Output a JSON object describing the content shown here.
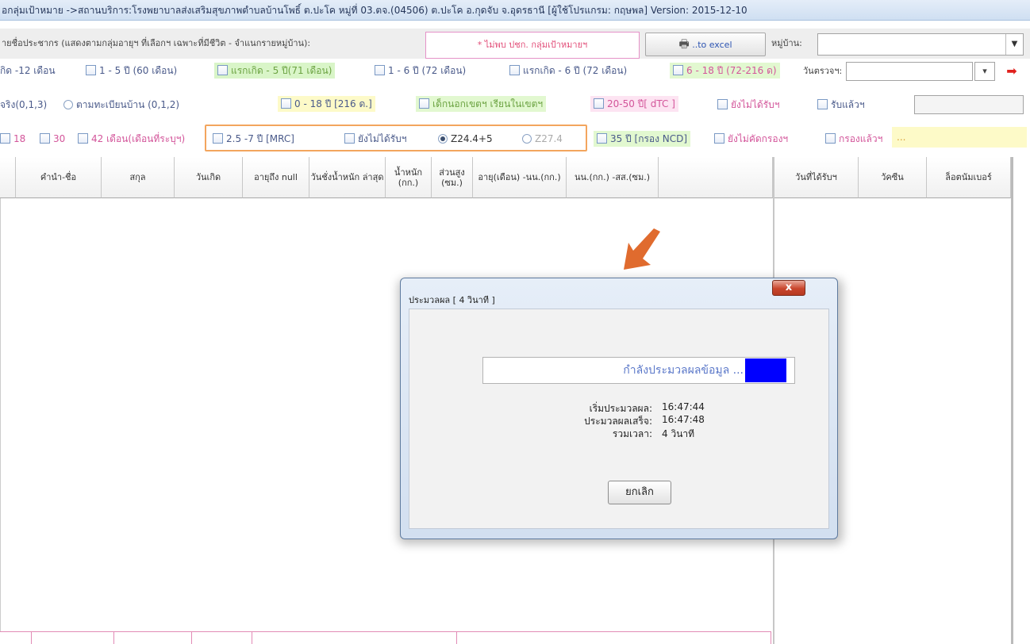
{
  "window": {
    "title": "อกลุ่มเป้าหมาย ->สถานบริการ:โรงพยาบาลส่งเสริมสุขภาพตำบลบ้านโพธิ์ ต.ปะโค หมู่ที่ 03.ตจ.(04506) ต.ปะโค อ.กุดจับ จ.อุดรธานี [ผู้ใช้โปรแกรม: กฤษพล] Version: 2015-12-10"
  },
  "toolbar": {
    "population_label": "ายชื่อประชากร (แสดงตามกลุ่มอายุฯ ที่เลือกฯ เฉพาะที่มีชีวิต - จำแนกรายหมู่บ้าน):",
    "warning_text": "* ไม่พบ ปชก. กลุ่มเป้าหมายฯ",
    "excel_button": "..to excel",
    "village_label": "หมู่บ้าน:",
    "village_value": ""
  },
  "filters_row1": {
    "items": [
      "กิด -12 เดือน",
      "1 - 5 ปี (60 เดือน)",
      "แรกเกิด - 5 ปี(71 เดือน)",
      "1 - 6 ปี (72 เดือน)",
      "แรกเกิด - 6 ปี (72 เดือน)",
      "6 - 18 ปี (72-216 ด)"
    ],
    "date_label": "วันตรวจฯ:"
  },
  "filters_row2": {
    "items": [
      "จริง(0,1,3)",
      "ตามทะเบียนบ้าน (0,1,2)",
      "0 - 18 ปี [216 ด.]",
      "เด็กนอกเขตฯ เรียนในเขตฯ",
      "20-50 ปี[ dTC ]",
      "ยังไม่ได้รับฯ",
      "รับแล้วฯ"
    ]
  },
  "filters_row3": {
    "items": [
      "18",
      "30",
      "42 เดือน(เดือนที่ระบุฯ)",
      "2.5 -7 ปี [MRC]",
      "ยังไม่ได้รับฯ",
      "Z24.4+5",
      "Z27.4",
      "35 ปี [กรอง NCD]",
      "ยังไม่คัดกรองฯ",
      "กรองแล้วฯ",
      "..."
    ]
  },
  "table": {
    "headers": [
      "คำนำ-ชื่อ",
      "สกุล",
      "วันเกิด",
      "อายุถึง null",
      "วันชั่งน้ำหนัก ล่าสุด",
      "น้ำหนัก (กก.)",
      "ส่วนสูง (ซม.)",
      "อายุ(เดือน) -นน.(กก.)",
      "นน.(กก.) -สส.(ซม.)"
    ],
    "right_headers": [
      "วันที่ได้รับฯ",
      "วัคซีน",
      "ล็อตนัมเบอร์"
    ],
    "footer": [
      "",
      "",
      "",
      "",
      ""
    ]
  },
  "dialog": {
    "title": "ประมวลผล [ 4 วินาที ]",
    "close_label": "x",
    "progress_text": "กำลังประมวลผลข้อมูล ...",
    "progress_fraction": 0.13,
    "start_label": "เริ่มประมวลผล:",
    "start_value": "16:47:44",
    "end_label": "ประมวลผลเสร็จ:",
    "end_value": "16:47:48",
    "total_label": "รวมเวลา:",
    "total_value": "4 วินาที",
    "cancel_button": "ยกเลิก"
  },
  "colors": {
    "arrow": "#e06b2e",
    "progress_fill": "#0000ff",
    "warning_pink": "#e24d78"
  }
}
